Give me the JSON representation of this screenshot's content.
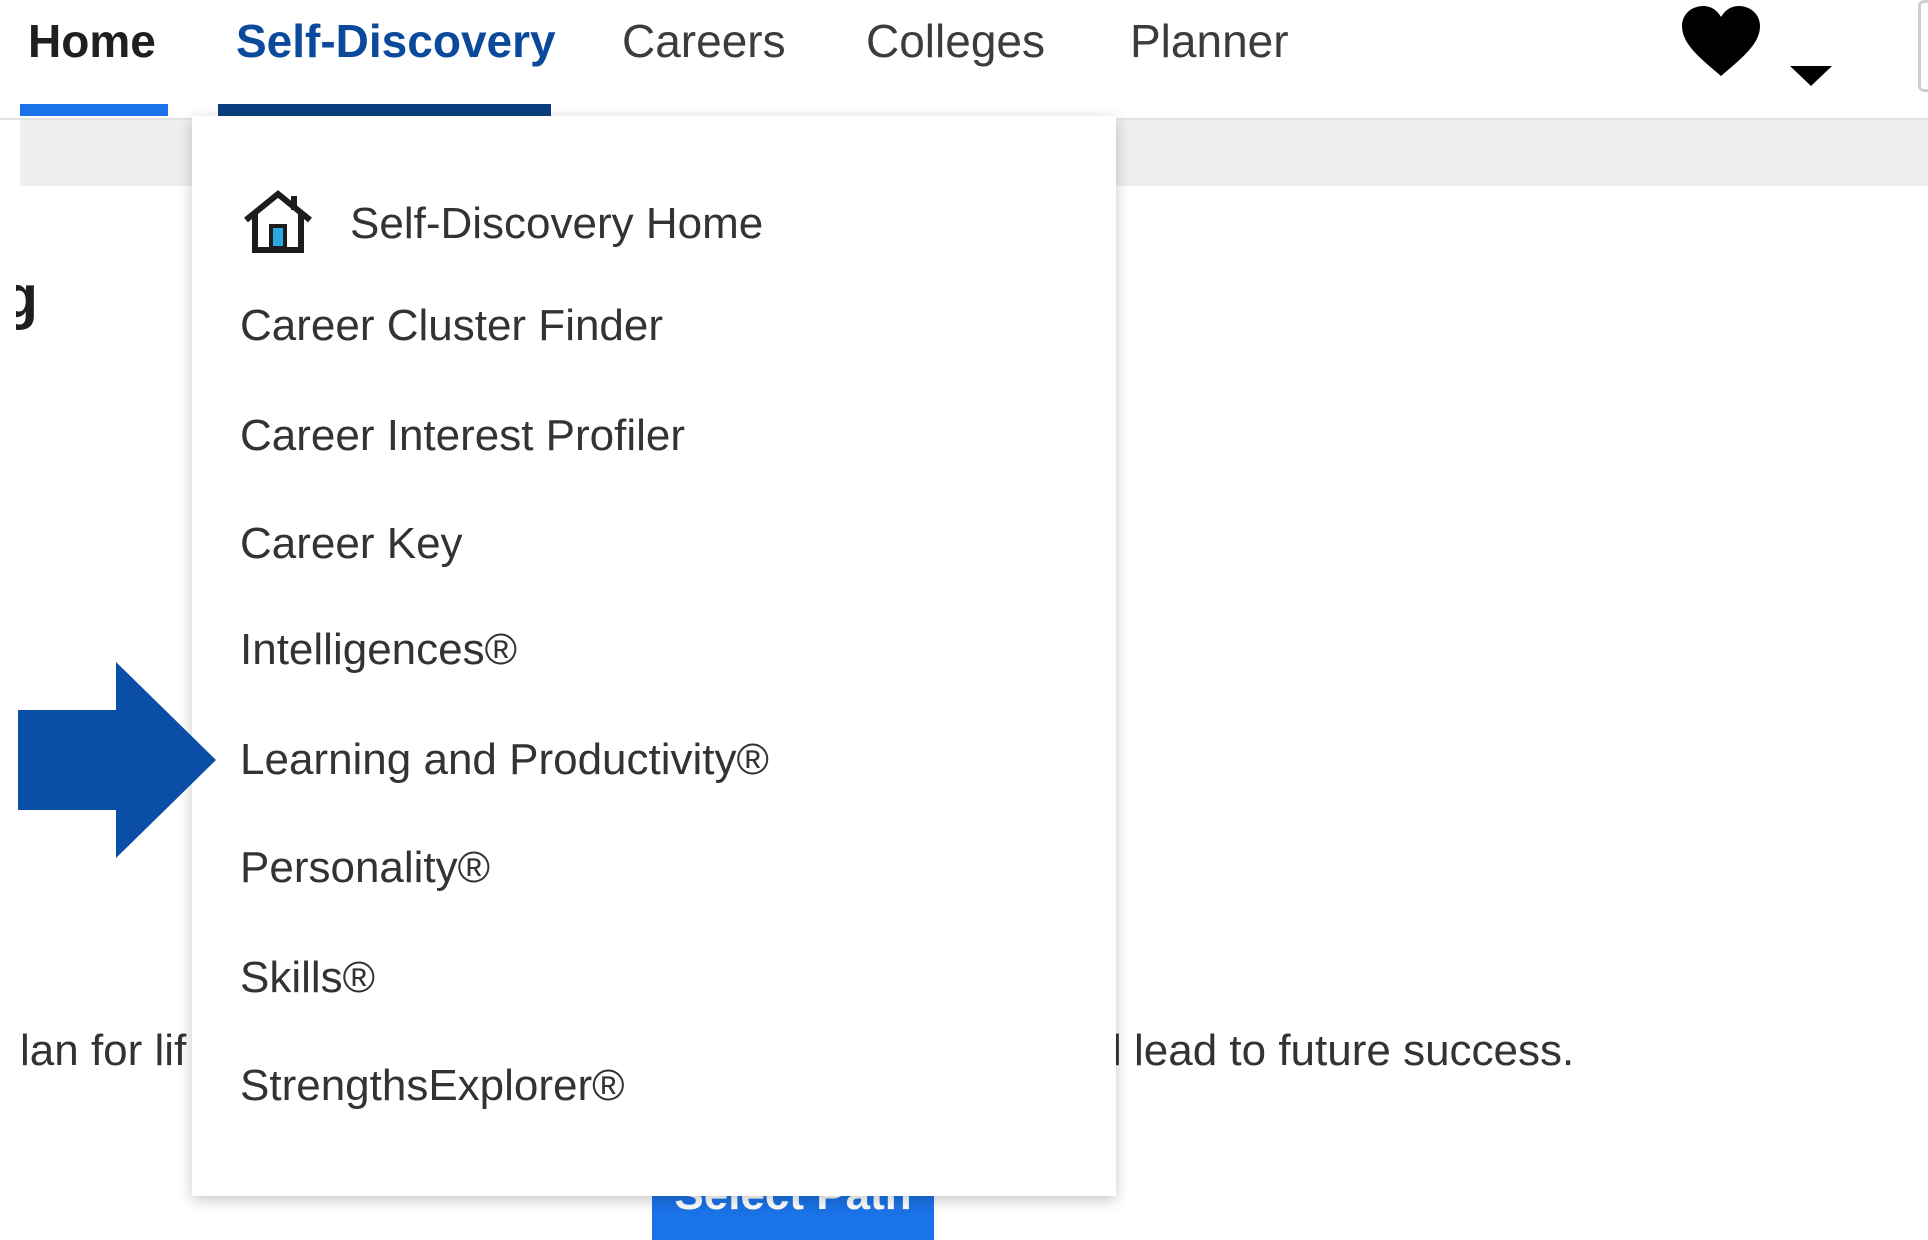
{
  "nav": {
    "home": "Home",
    "self_discovery": "Self-Discovery",
    "careers": "Careers",
    "colleges": "Colleges",
    "planner": "Planner",
    "favorites_icon": "heart-icon",
    "account_menu_icon": "caret-down-icon"
  },
  "page": {
    "heading_fragment": "ng",
    "body_left": "lan for lif",
    "body_right": "l lead to future success.",
    "button_label": "Select Path"
  },
  "dropdown": {
    "home_icon": "house-icon",
    "items": [
      "Self-Discovery Home",
      "Career Cluster Finder",
      "Career Interest Profiler",
      "Career Key",
      "Intelligences®",
      "Learning and Productivity®",
      "Personality®",
      "Skills®",
      "StrengthsExplorer®"
    ]
  },
  "callout": {
    "icon": "arrow-right-icon",
    "points_to": "Learning and Productivity®"
  },
  "colors": {
    "active_tab_underline": "#1a73e8",
    "selected_tab_underline": "#0b3f80",
    "selected_tab_text": "#0b4a9b",
    "callout_arrow": "#0b4ea8",
    "button": "#1a73e8"
  }
}
